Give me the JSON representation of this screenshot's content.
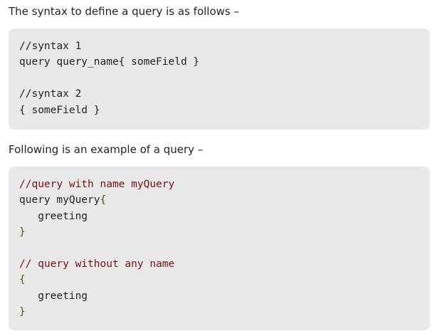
{
  "intro_text": "The syntax to define a query is as follows –",
  "syntax_block": {
    "lines": [
      "//syntax 1",
      "query query_name{ someField }",
      "",
      "//syntax 2",
      "{ someField }"
    ]
  },
  "example_intro_text": "Following is an example of a query –",
  "example_block": {
    "lines": [
      [
        {
          "text": "//query with name myQuery",
          "kind": "comment"
        }
      ],
      [
        {
          "text": "query myQuery",
          "kind": "plain"
        },
        {
          "text": "{",
          "kind": "brace"
        }
      ],
      [
        {
          "text": "   greeting",
          "kind": "plain"
        }
      ],
      [
        {
          "text": "}",
          "kind": "brace"
        }
      ],
      [],
      [
        {
          "text": "// query without any name",
          "kind": "comment"
        }
      ],
      [
        {
          "text": "{",
          "kind": "brace"
        }
      ],
      [
        {
          "text": "   greeting",
          "kind": "plain"
        }
      ],
      [
        {
          "text": "}",
          "kind": "brace"
        }
      ]
    ]
  },
  "colors": {
    "code_background": "#e9e9e9",
    "comment": "#7a1012",
    "brace": "#4f5b15",
    "text": "#222222"
  }
}
